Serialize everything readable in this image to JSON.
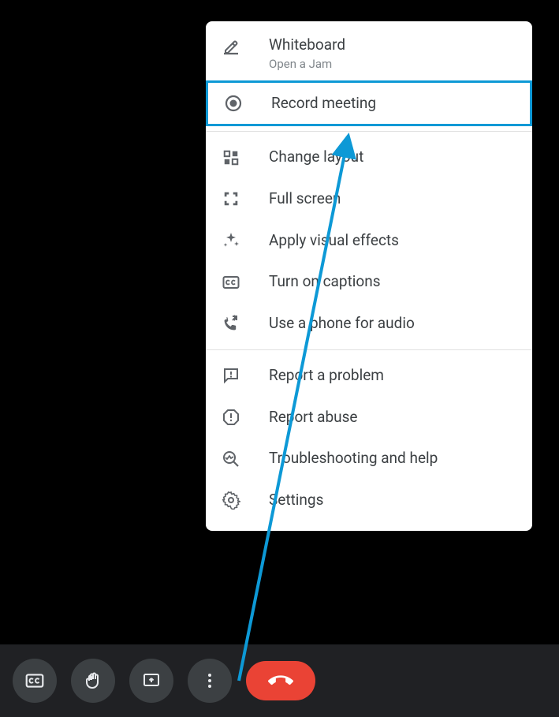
{
  "menu": {
    "whiteboard": {
      "label": "Whiteboard",
      "subtitle": "Open a Jam"
    },
    "record": {
      "label": "Record meeting"
    },
    "layout": {
      "label": "Change layout"
    },
    "fullscreen": {
      "label": "Full screen"
    },
    "effects": {
      "label": "Apply visual effects"
    },
    "captions": {
      "label": "Turn on captions"
    },
    "phone": {
      "label": "Use a phone for audio"
    },
    "report_problem": {
      "label": "Report a problem"
    },
    "report_abuse": {
      "label": "Report abuse"
    },
    "troubleshoot": {
      "label": "Troubleshooting and help"
    },
    "settings": {
      "label": "Settings"
    }
  },
  "annotation": {
    "highlight_color": "#0d99d6"
  }
}
